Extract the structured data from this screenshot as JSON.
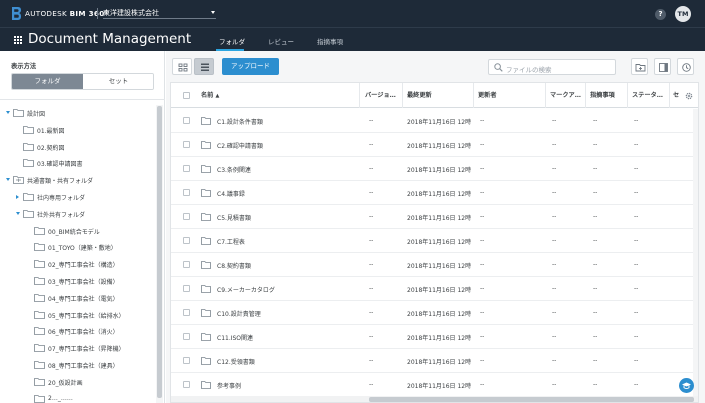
{
  "topbar": {
    "brand_prefix": "AUTODESK",
    "brand_product": "BIM 360",
    "brand_trademark": "°",
    "account": "東洋建設株式会社",
    "help_label": "?",
    "avatar_initials": "TM"
  },
  "header": {
    "title": "Document Management",
    "tabs": [
      {
        "label": "フォルダ",
        "active": true
      },
      {
        "label": "レビュー",
        "active": false
      },
      {
        "label": "指摘事項",
        "active": false
      }
    ]
  },
  "sidebar": {
    "display_label": "表示方法",
    "segment": {
      "folder": "フォルダ",
      "set": "セット"
    },
    "tree": [
      {
        "label": "設計図",
        "level": 0,
        "toggle": "open",
        "kind": "folder"
      },
      {
        "label": "01.最新図",
        "level": 1,
        "toggle": "none",
        "kind": "folder"
      },
      {
        "label": "02.契約図",
        "level": 1,
        "toggle": "none",
        "kind": "folder"
      },
      {
        "label": "03.確認申請図書",
        "level": 1,
        "toggle": "none",
        "kind": "folder"
      },
      {
        "label": "共通書類・共有フォルダ",
        "level": 0,
        "toggle": "open",
        "kind": "shared"
      },
      {
        "label": "社内専用フォルダ",
        "level": 1,
        "toggle": "closed",
        "kind": "folder"
      },
      {
        "label": "社外共有フォルダ",
        "level": 1,
        "toggle": "open",
        "kind": "folder"
      },
      {
        "label": "00_BIM統合モデル",
        "level": 2,
        "toggle": "none",
        "kind": "folder"
      },
      {
        "label": "01_TOYO（建築・敷地）",
        "level": 2,
        "toggle": "none",
        "kind": "folder"
      },
      {
        "label": "02_専門工事会社（構造）",
        "level": 2,
        "toggle": "none",
        "kind": "folder"
      },
      {
        "label": "03_専門工事会社（設備）",
        "level": 2,
        "toggle": "none",
        "kind": "folder"
      },
      {
        "label": "04_専門工事会社（電気）",
        "level": 2,
        "toggle": "none",
        "kind": "folder"
      },
      {
        "label": "05_専門工事会社（給排水）",
        "level": 2,
        "toggle": "none",
        "kind": "folder"
      },
      {
        "label": "06_専門工事会社（消火）",
        "level": 2,
        "toggle": "none",
        "kind": "folder"
      },
      {
        "label": "07_専門工事会社（昇降機）",
        "level": 2,
        "toggle": "none",
        "kind": "folder"
      },
      {
        "label": "08_専門工事会社（建具）",
        "level": 2,
        "toggle": "none",
        "kind": "folder"
      },
      {
        "label": "20_仮設計画",
        "level": 2,
        "toggle": "none",
        "kind": "folder"
      },
      {
        "label": "2…_……",
        "level": 2,
        "toggle": "none",
        "kind": "folder"
      }
    ]
  },
  "toolbar": {
    "upload_label": "アップロード",
    "search_placeholder": "ファイルの検索"
  },
  "table": {
    "columns": [
      "名前",
      "バージョ…",
      "最終更新",
      "更新者",
      "マークア…",
      "指摘事項",
      "ステータ…",
      "セ"
    ],
    "sort_indicator": "▲",
    "rows": [
      {
        "name": "C1.設計条件書類",
        "version": "--",
        "updated": "2018年11月16日 12時…",
        "updater": "--",
        "markup": "--",
        "issues": "--",
        "status": "--"
      },
      {
        "name": "C2.確認申請書類",
        "version": "--",
        "updated": "2018年11月16日 12時…",
        "updater": "--",
        "markup": "--",
        "issues": "--",
        "status": "--"
      },
      {
        "name": "C3.条例関連",
        "version": "--",
        "updated": "2018年11月16日 12時…",
        "updater": "--",
        "markup": "--",
        "issues": "--",
        "status": "--"
      },
      {
        "name": "C4.議事録",
        "version": "--",
        "updated": "2018年11月16日 12時…",
        "updater": "--",
        "markup": "--",
        "issues": "--",
        "status": "--"
      },
      {
        "name": "C5.見積書類",
        "version": "--",
        "updated": "2018年11月16日 12時…",
        "updater": "--",
        "markup": "--",
        "issues": "--",
        "status": "--"
      },
      {
        "name": "C7.工程表",
        "version": "--",
        "updated": "2018年11月16日 12時…",
        "updater": "--",
        "markup": "--",
        "issues": "--",
        "status": "--"
      },
      {
        "name": "C8.契約書類",
        "version": "--",
        "updated": "2018年11月16日 12時…",
        "updater": "--",
        "markup": "--",
        "issues": "--",
        "status": "--"
      },
      {
        "name": "C9.メーカーカタログ",
        "version": "--",
        "updated": "2018年11月16日 12時…",
        "updater": "--",
        "markup": "--",
        "issues": "--",
        "status": "--"
      },
      {
        "name": "C10.設計責管理",
        "version": "--",
        "updated": "2018年11月16日 12時…",
        "updater": "--",
        "markup": "--",
        "issues": "--",
        "status": "--"
      },
      {
        "name": "C11.ISO関連",
        "version": "--",
        "updated": "2018年11月16日 12時…",
        "updater": "--",
        "markup": "--",
        "issues": "--",
        "status": "--"
      },
      {
        "name": "C12.受領書類",
        "version": "--",
        "updated": "2018年11月16日 12時…",
        "updater": "--",
        "markup": "--",
        "issues": "--",
        "status": "--"
      },
      {
        "name": "参考事例",
        "version": "--",
        "updated": "2018年11月16日 12時…",
        "updater": "--",
        "markup": "--",
        "issues": "--",
        "status": "--"
      }
    ]
  },
  "colors": {
    "topbar": "#1e2a38",
    "accent": "#2c8ecf",
    "segment_active": "#7d8894"
  },
  "icons": {
    "logo": "autodesk-b-logo",
    "apps": "grid-icon",
    "search": "search-icon",
    "folder": "folder-icon",
    "settings": "gear-icon",
    "help": "help-icon"
  }
}
